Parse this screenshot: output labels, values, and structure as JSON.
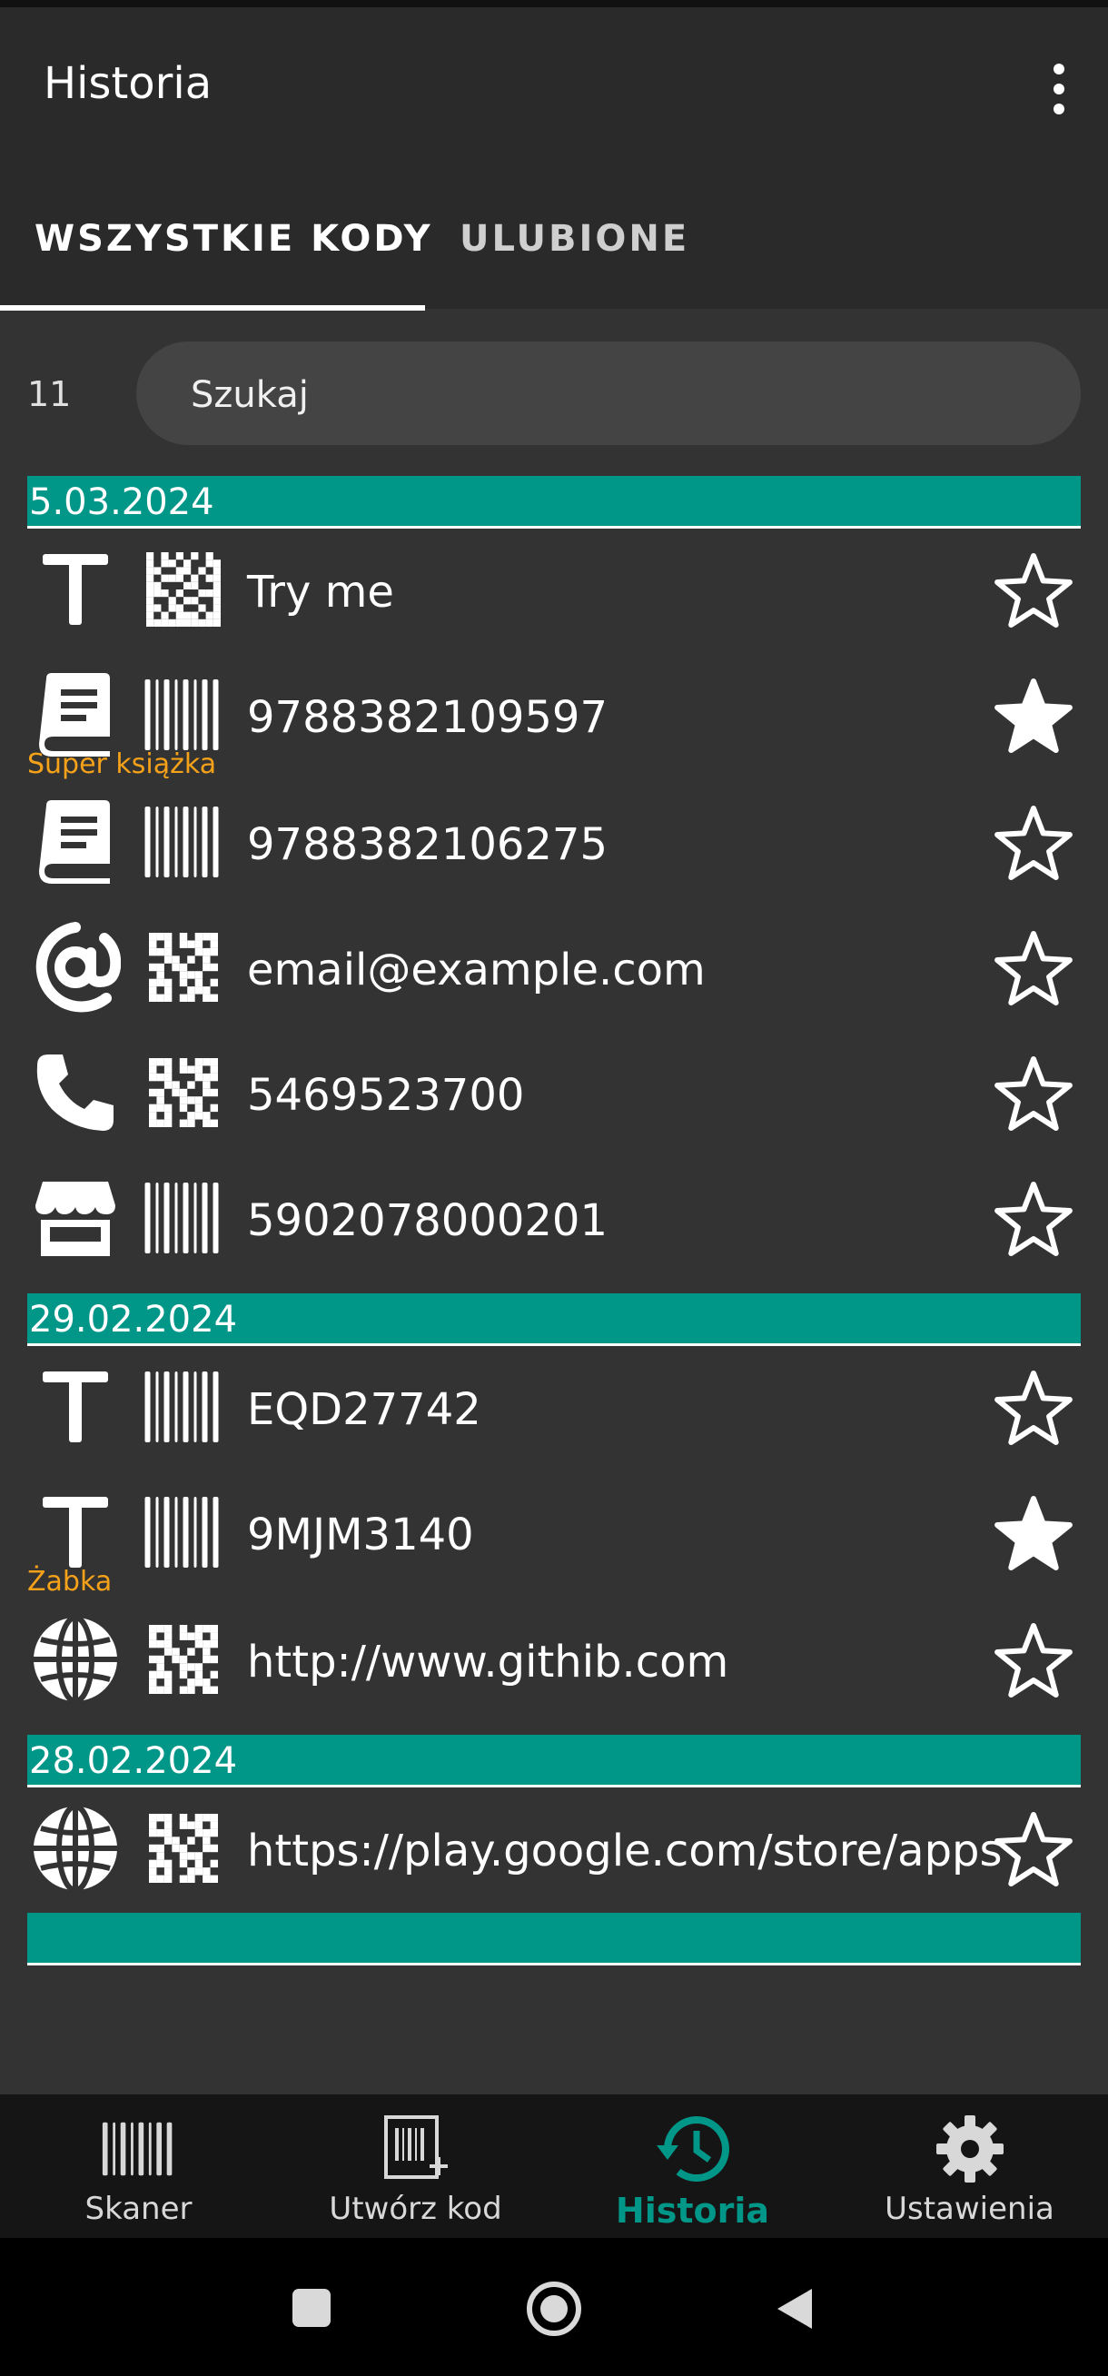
{
  "app": {
    "title": "Historia",
    "menu_icon": "more-vert-icon"
  },
  "tabs": [
    {
      "label": "WSZYSTKIE KODY",
      "active": true
    },
    {
      "label": "ULUBIONE",
      "active": false
    }
  ],
  "search": {
    "count": "11",
    "placeholder": "Szukaj"
  },
  "groups": [
    {
      "date": "5.03.2024",
      "items": [
        {
          "type_icon": "text-icon",
          "code_icon": "datamatrix-icon",
          "text": "Try me",
          "favorite": false,
          "note": ""
        },
        {
          "type_icon": "book-icon",
          "code_icon": "barcode-icon",
          "text": "9788382109597",
          "favorite": true,
          "note": "Super książka"
        },
        {
          "type_icon": "book-icon",
          "code_icon": "barcode-icon",
          "text": "9788382106275",
          "favorite": false,
          "note": ""
        },
        {
          "type_icon": "email-icon",
          "code_icon": "qr-code-icon",
          "text": "email@example.com",
          "favorite": false,
          "note": ""
        },
        {
          "type_icon": "phone-icon",
          "code_icon": "qr-code-icon",
          "text": "5469523700",
          "favorite": false,
          "note": ""
        },
        {
          "type_icon": "store-icon",
          "code_icon": "barcode-icon",
          "text": "5902078000201",
          "favorite": false,
          "note": ""
        }
      ]
    },
    {
      "date": "29.02.2024",
      "items": [
        {
          "type_icon": "text-icon",
          "code_icon": "barcode-icon",
          "text": "EQD27742",
          "favorite": false,
          "note": ""
        },
        {
          "type_icon": "text-icon",
          "code_icon": "barcode-icon",
          "text": "9MJM3140",
          "favorite": true,
          "note": "Żabka"
        },
        {
          "type_icon": "globe-icon",
          "code_icon": "qr-code-icon",
          "text": "http://www.githib.com",
          "favorite": false,
          "note": ""
        }
      ]
    },
    {
      "date": "28.02.2024",
      "items": [
        {
          "type_icon": "globe-icon",
          "code_icon": "qr-code-icon",
          "text": "https://play.google.com/store/apps",
          "favorite": false,
          "note": ""
        }
      ]
    }
  ],
  "bottom_nav": [
    {
      "label": "Skaner",
      "icon": "barcode-scanner-icon",
      "active": false
    },
    {
      "label": "Utwórz kod",
      "icon": "create-code-icon",
      "active": false
    },
    {
      "label": "Historia",
      "icon": "history-icon",
      "active": true
    },
    {
      "label": "Ustawienia",
      "icon": "settings-icon",
      "active": false
    }
  ],
  "system_nav": [
    "recents-icon",
    "home-icon",
    "back-icon"
  ],
  "colors": {
    "accent": "#009688",
    "note": "#f5a21a",
    "background": "#333333",
    "app_bar": "#2a2a2a"
  }
}
